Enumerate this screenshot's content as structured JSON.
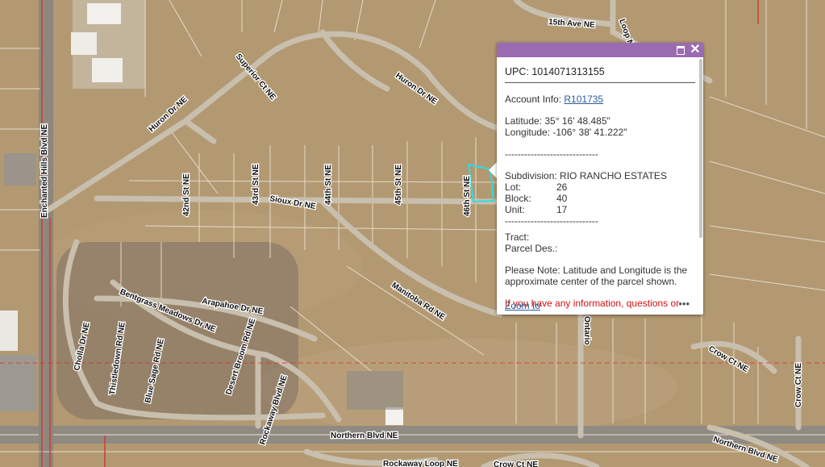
{
  "map": {
    "street_labels": [
      "15th Ave NE",
      "Loop NE",
      "Superior Ct NE",
      "Huron Dr NE",
      "Huron Dr NE",
      "Enchanted Hills Blvd NE",
      "42nd St NE",
      "43rd St NE",
      "44th St NE",
      "45th St NE",
      "46th St NE",
      "Sioux Dr NE",
      "Manitoba Rd NE",
      "Arapahoe Dr NE",
      "Bentgrass Meadows Dr NE",
      "Cholla Dr NE",
      "Thistledown Rd NE",
      "Blue Sage Rd NE",
      "Desert Broom Rd NE",
      "Rockaway Blvd NE",
      "Northern Blvd NE",
      "Northern Blvd NE",
      "Rockaway Loop NE",
      "Ontario",
      "Crow Ct NE",
      "Crow Ct NE",
      "Crow Ct NE"
    ],
    "colors": {
      "parcel_line": "#efe6d8",
      "boundary": "#d2352b",
      "selection": "#2cdde0",
      "popup_header": "#9b6bb1"
    }
  },
  "popup": {
    "title": "UPC: 1014071313155",
    "account_label": "Account Info: ",
    "account_link": "R101735",
    "latitude": "Latitude: 35° 16' 48.485\"",
    "longitude": "Longitude: -106° 38' 41.222\"",
    "divider1": "-----------------------------",
    "subdivision": "Subdivision: RIO RANCHO ESTATES",
    "lot_label": "Lot:",
    "lot_value": "26",
    "block_label": "Block:",
    "block_value": "40",
    "unit_label": "Unit:",
    "unit_value": "17",
    "divider2": "-----------------------------",
    "tract": "Tract:",
    "parcel_des": "Parcel Des.:",
    "note": "Please Note: Latitude and Longitude is the approximate center of the parcel shown.",
    "red_text": "If you have any information, questions or",
    "zoom_link": "Zoom to",
    "more_label": "•••",
    "maximize_icon": "maximize-icon",
    "close_icon": "close-icon",
    "close_glyph": "✕"
  }
}
